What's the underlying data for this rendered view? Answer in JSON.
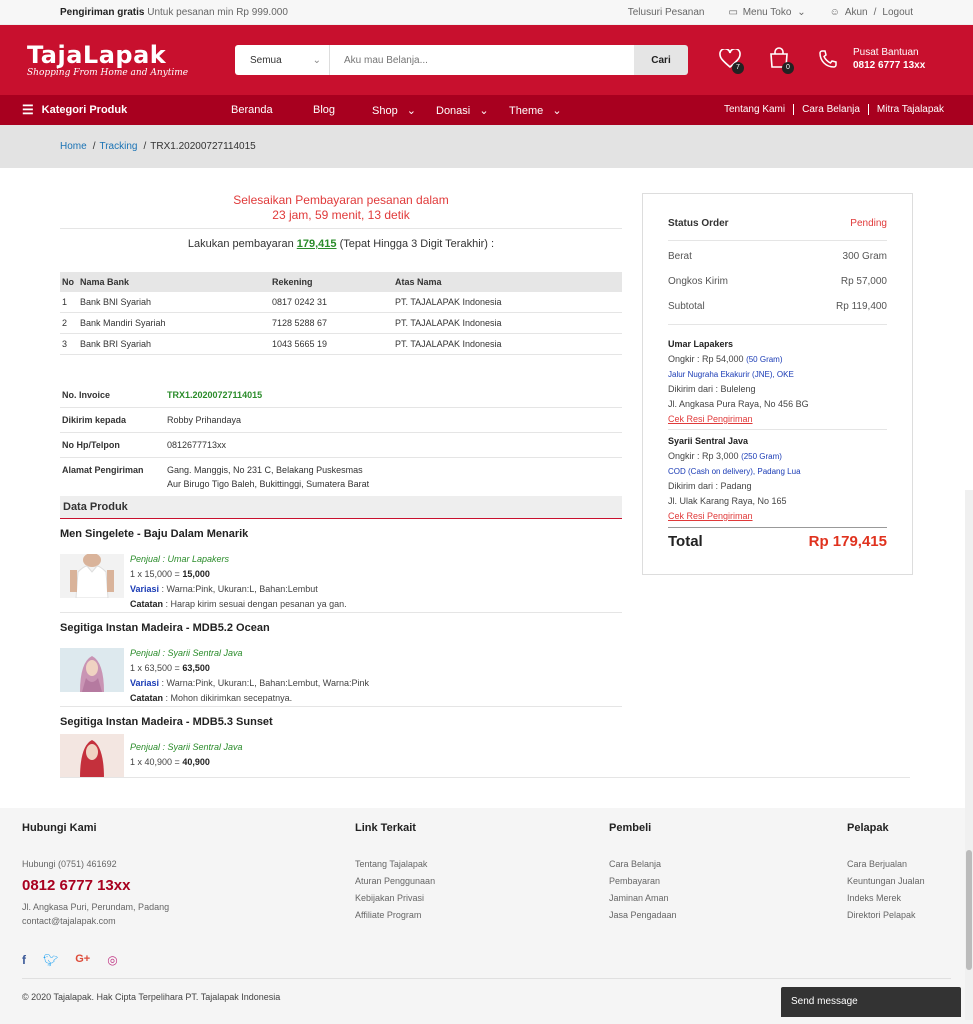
{
  "topbar": {
    "shipping_bold": "Pengiriman gratis",
    "shipping_text": "Untuk pesanan min Rp 999.000",
    "track": "Telusuri Pesanan",
    "store_menu": "Menu Toko",
    "account": "Akun",
    "slash": "/",
    "logout": "Logout"
  },
  "header": {
    "logo_title": "TajaLapak",
    "logo_tagline": "Shopping From Home and Anytime",
    "search_category": "Semua",
    "search_placeholder": "Aku mau Belanja...",
    "search_button": "Cari",
    "wishlist_count": "7",
    "cart_count": "0",
    "help_label": "Pusat Bantuan",
    "help_phone": "0812 6777 13xx"
  },
  "nav": {
    "categories": "Kategori Produk",
    "items": [
      "Beranda",
      "Blog",
      "Shop",
      "Donasi",
      "Theme"
    ],
    "right": [
      "Tentang Kami",
      "Cara Belanja",
      "Mitra Tajalapak"
    ]
  },
  "breadcrumb": {
    "home": "Home",
    "tracking": "Tracking",
    "current": "TRX1.20200727114015",
    "sep": "/"
  },
  "payment": {
    "timer_line1": "Selesaikan Pembayaran pesanan dalam",
    "timer_line2": "23 jam, 59 menit, 13 detik",
    "instruction_pre": "Lakukan pembayaran",
    "amount": "179,415",
    "instruction_post": "(Tepat Hingga 3 Digit Terakhir) :"
  },
  "bank_table": {
    "headers": [
      "No",
      "Nama Bank",
      "Rekening",
      "Atas Nama"
    ],
    "rows": [
      [
        "1",
        "Bank BNI Syariah",
        "0817 0242 31",
        "PT. TAJALAPAK Indonesia"
      ],
      [
        "2",
        "Bank Mandiri Syariah",
        "7128 5288 67",
        "PT. TAJALAPAK Indonesia"
      ],
      [
        "3",
        "Bank BRI Syariah",
        "1043 5665 19",
        "PT. TAJALAPAK Indonesia"
      ]
    ]
  },
  "invoice": {
    "no_label": "No. Invoice",
    "no_value": "TRX1.20200727114015",
    "to_label": "Dikirim kepada",
    "to_value": "Robby Prihandaya",
    "phone_label": "No Hp/Telpon",
    "phone_value": "0812677713xx",
    "address_label": "Alamat Pengiriman",
    "address_line1": "Gang. Manggis, No 231 C, Belakang Puskesmas",
    "address_line2": "Aur Birugo Tigo Baleh, Bukittinggi, Sumatera Barat"
  },
  "products": {
    "title": "Data Produk",
    "items": [
      {
        "name": "Men Singelete - Baju Dalam Menarik",
        "seller": "Penjual : Umar Lapakers",
        "qty_calc": "1 x 15,000 =",
        "total": "15,000",
        "variant_label": "Variasi",
        "variant": ": Warna:Pink, Ukuran:L, Bahan:Lembut",
        "note_label": "Catatan",
        "note": ": Harap kirim sesuai dengan pesanan ya gan."
      },
      {
        "name": "Segitiga Instan Madeira - MDB5.2 Ocean",
        "seller": "Penjual : Syarii Sentral Java",
        "qty_calc": "1 x 63,500 =",
        "total": "63,500",
        "variant_label": "Variasi",
        "variant": ": Warna:Pink, Ukuran:L, Bahan:Lembut, Warna:Pink",
        "note_label": "Catatan",
        "note": ": Mohon dikirimkan secepatnya."
      },
      {
        "name": "Segitiga Instan Madeira - MDB5.3 Sunset",
        "seller": "Penjual : Syarii Sentral Java",
        "qty_calc": "1 x 40,900 =",
        "total": "40,900"
      }
    ]
  },
  "summary": {
    "status_label": "Status Order",
    "status_value": "Pending",
    "weight_label": "Berat",
    "weight_value": "300 Gram",
    "shipping_label": "Ongkos Kirim",
    "shipping_value": "Rp 57,000",
    "subtotal_label": "Subtotal",
    "subtotal_value": "Rp 119,400",
    "sellers": [
      {
        "name": "Umar Lapakers",
        "ongkir": "Ongkir : Rp 54,000",
        "weight": "(50 Gram)",
        "courier": "Jalur Nugraha Ekakurir (JNE), OKE",
        "from": "Dikirim dari : Buleleng",
        "address": "Jl. Angkasa Pura Raya, No 456 BG",
        "resi": "Cek Resi Pengiriman"
      },
      {
        "name": "Syarii Sentral Java",
        "ongkir": "Ongkir : Rp 3,000",
        "weight": "(250 Gram)",
        "courier": "COD (Cash on delivery), Padang Lua",
        "from": "Dikirim dari : Padang",
        "address": "Jl. Ulak Karang Raya, No 165",
        "resi": "Cek Resi Pengiriman"
      }
    ],
    "total_label": "Total",
    "total_value": "Rp 179,415"
  },
  "footer": {
    "contact_title": "Hubungi Kami",
    "contact_line": "Hubungi (0751) 461692",
    "phone": "0812 6777 13xx",
    "address": "Jl. Angkasa Puri, Perundam, Padang",
    "email": "contact@tajalapak.com",
    "links_title": "Link Terkait",
    "links": [
      "Tentang Tajalapak",
      "Aturan Penggunaan",
      "Kebijakan Privasi",
      "Affiliate Program"
    ],
    "buyer_title": "Pembeli",
    "buyer": [
      "Cara Belanja",
      "Pembayaran",
      "Jaminan Aman",
      "Jasa Pengadaan"
    ],
    "seller_title": "Pelapak",
    "seller": [
      "Cara Berjualan",
      "Keuntungan Jualan",
      "Indeks Merek",
      "Direktori Pelapak"
    ],
    "copyright": "© 2020 Tajalapak. Hak Cipta Terpelihara PT. Tajalapak Indonesia",
    "send_message": "Send message"
  },
  "colors": {
    "brand": "#c8102e",
    "nav": "#a8001f",
    "green": "#2a8c2a",
    "accent_red": "#e03a3a"
  }
}
